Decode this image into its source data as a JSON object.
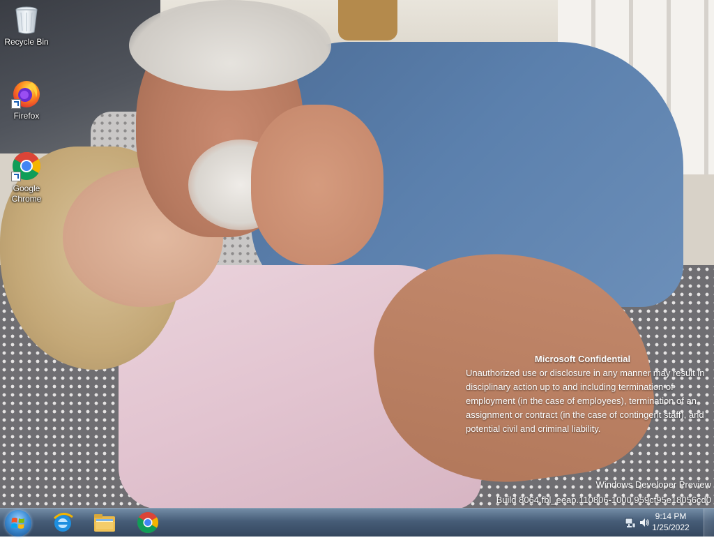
{
  "desktop": {
    "icons": [
      {
        "label": "Recycle Bin",
        "icon": "recycle-bin-icon"
      },
      {
        "label": "Firefox",
        "icon": "firefox-icon"
      },
      {
        "label": "Google Chrome",
        "icon": "chrome-icon"
      }
    ]
  },
  "watermark": {
    "title": "Microsoft Confidential",
    "body": "Unauthorized use or disclosure in any manner may result in disciplinary action up to and including termination of employment (in the case of employees), termination of an assignment or contract (in the case of contingent staff), and potential civil and criminal liability.",
    "edition": "Windows Developer Preview",
    "build": "Build 8064.fbl_eeap.110806-1000.959cf95e18056cd0"
  },
  "taskbar": {
    "pinned": [
      {
        "name": "Internet Explorer",
        "icon": "internet-explorer-icon"
      },
      {
        "name": "Windows Explorer",
        "icon": "file-explorer-icon"
      },
      {
        "name": "Google Chrome",
        "icon": "chrome-icon"
      }
    ],
    "tray": {
      "time": "9:14 PM",
      "date": "1/25/2022"
    }
  },
  "colors": {
    "taskbar": "#324b69",
    "text": "#ffffff"
  }
}
